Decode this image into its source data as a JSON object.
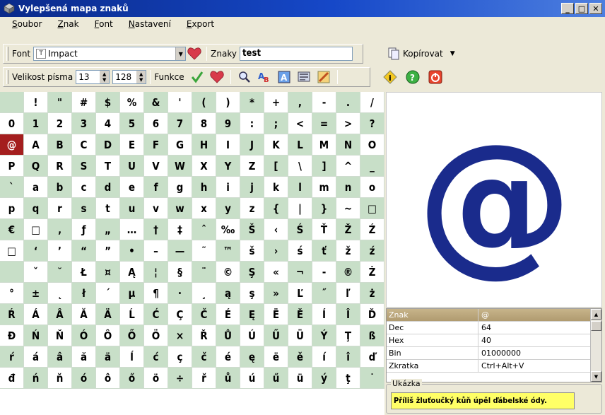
{
  "window": {
    "title": "Vylepšená mapa znaků",
    "buttons": [
      "_",
      "□",
      "✕"
    ]
  },
  "menu": [
    {
      "label": "Soubor",
      "key": "S",
      "rest": "oubor"
    },
    {
      "label": "Znak",
      "key": "Z",
      "rest": "nak"
    },
    {
      "label": "Font",
      "key": "F",
      "rest": "ont"
    },
    {
      "label": "Nastavení",
      "key": "N",
      "rest": "astavení"
    },
    {
      "label": "Export",
      "key": "E",
      "rest": "xport"
    }
  ],
  "toolbar1": {
    "font_label": "Font",
    "font_value": "Impact",
    "chars_label": "Znaky",
    "chars_value": "test",
    "copy_label": "Kopírovat"
  },
  "toolbar2": {
    "size_label": "Velikost písma",
    "size_value": "13",
    "size2_value": "128",
    "func_label": "Funkce"
  },
  "grid": {
    "rows": [
      [
        " ",
        "!",
        "\"",
        "#",
        "$",
        "%",
        "&",
        "'",
        "(",
        ")",
        "*",
        "+",
        ",",
        "-",
        ".",
        "/"
      ],
      [
        "0",
        "1",
        "2",
        "3",
        "4",
        "5",
        "6",
        "7",
        "8",
        "9",
        ":",
        ";",
        "<",
        "=",
        ">",
        "?"
      ],
      [
        "@",
        "A",
        "B",
        "C",
        "D",
        "E",
        "F",
        "G",
        "H",
        "I",
        "J",
        "K",
        "L",
        "M",
        "N",
        "O"
      ],
      [
        "P",
        "Q",
        "R",
        "S",
        "T",
        "U",
        "V",
        "W",
        "X",
        "Y",
        "Z",
        "[",
        "\\",
        "]",
        "^",
        "_"
      ],
      [
        "`",
        "a",
        "b",
        "c",
        "d",
        "e",
        "f",
        "g",
        "h",
        "i",
        "j",
        "k",
        "l",
        "m",
        "n",
        "o"
      ],
      [
        "p",
        "q",
        "r",
        "s",
        "t",
        "u",
        "v",
        "w",
        "x",
        "y",
        "z",
        "{",
        "|",
        "}",
        "~",
        "□"
      ],
      [
        "€",
        "□",
        "‚",
        "ƒ",
        "„",
        "…",
        "†",
        "‡",
        "ˆ",
        "‰",
        "Š",
        "‹",
        "Ś",
        "Ť",
        "Ž",
        "Ź"
      ],
      [
        "□",
        "‘",
        "’",
        "“",
        "”",
        "•",
        "–",
        "—",
        "˜",
        "™",
        "š",
        "›",
        "ś",
        "ť",
        "ž",
        "ź"
      ],
      [
        " ",
        "ˇ",
        "˘",
        "Ł",
        "¤",
        "Ą",
        "¦",
        "§",
        "¨",
        "©",
        "Ş",
        "«",
        "¬",
        "-",
        "®",
        "Ż"
      ],
      [
        "°",
        "±",
        "˛",
        "ł",
        "´",
        "µ",
        "¶",
        "·",
        "¸",
        "ą",
        "ş",
        "»",
        "Ľ",
        "˝",
        "ľ",
        "ż"
      ],
      [
        "Ŕ",
        "Á",
        "Â",
        "Ă",
        "Ä",
        "Ĺ",
        "Ć",
        "Ç",
        "Č",
        "É",
        "Ę",
        "Ë",
        "Ě",
        "Í",
        "Î",
        "Ď"
      ],
      [
        "Đ",
        "Ń",
        "Ň",
        "Ó",
        "Ô",
        "Ő",
        "Ö",
        "×",
        "Ř",
        "Ů",
        "Ú",
        "Ű",
        "Ü",
        "Ý",
        "Ţ",
        "ß"
      ],
      [
        "ŕ",
        "á",
        "â",
        "ă",
        "ä",
        "ĺ",
        "ć",
        "ç",
        "č",
        "é",
        "ę",
        "ë",
        "ě",
        "í",
        "î",
        "ď"
      ],
      [
        "đ",
        "ń",
        "ň",
        "ó",
        "ô",
        "ő",
        "ö",
        "÷",
        "ř",
        "ů",
        "ú",
        "ű",
        "ü",
        "ý",
        "ţ",
        "˙"
      ]
    ],
    "selected": "@",
    "colors": {
      "even": "#c8dfc8",
      "odd": "#ffffff",
      "selected": "#a41e1e"
    }
  },
  "preview": {
    "char": "@",
    "color": "#1a2b8c"
  },
  "info": {
    "header": {
      "k": "Znak",
      "v": "@"
    },
    "rows": [
      {
        "k": "Dec",
        "v": "64"
      },
      {
        "k": "Hex",
        "v": "40"
      },
      {
        "k": "Bin",
        "v": "01000000"
      },
      {
        "k": "Zkratka",
        "v": "Ctrl+Alt+V"
      }
    ]
  },
  "sample": {
    "label": "Ukázka",
    "text": "Příliš žluťoučký kůň úpěl ďábelské ódy."
  }
}
